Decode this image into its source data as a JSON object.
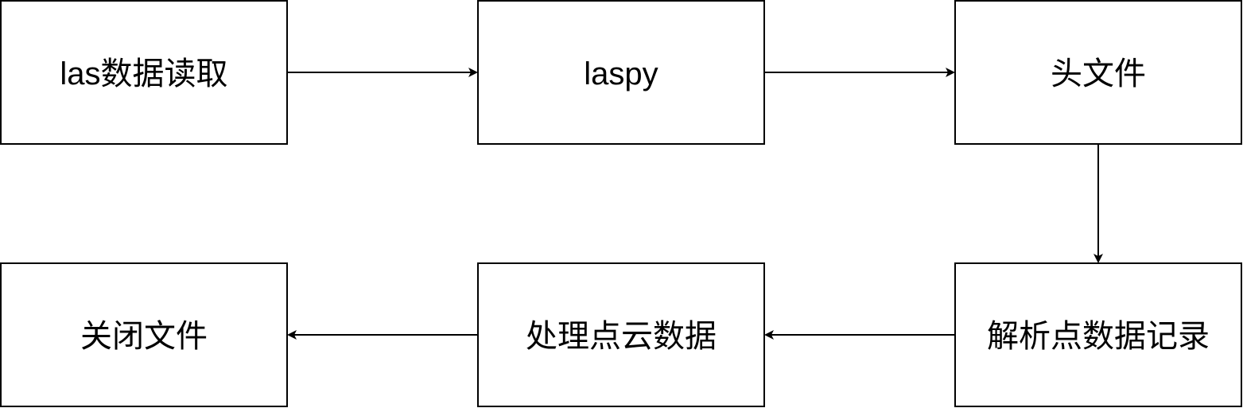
{
  "nodes": [
    {
      "id": "read",
      "label": "las数据读取"
    },
    {
      "id": "laspy",
      "label": "laspy"
    },
    {
      "id": "header",
      "label": "头文件"
    },
    {
      "id": "parse",
      "label": "解析点数据记录"
    },
    {
      "id": "process",
      "label": "处理点云数据"
    },
    {
      "id": "close",
      "label": "关闭文件"
    }
  ],
  "edges": [
    {
      "from": "read",
      "to": "laspy"
    },
    {
      "from": "laspy",
      "to": "header"
    },
    {
      "from": "header",
      "to": "parse"
    },
    {
      "from": "parse",
      "to": "process"
    },
    {
      "from": "process",
      "to": "close"
    }
  ]
}
